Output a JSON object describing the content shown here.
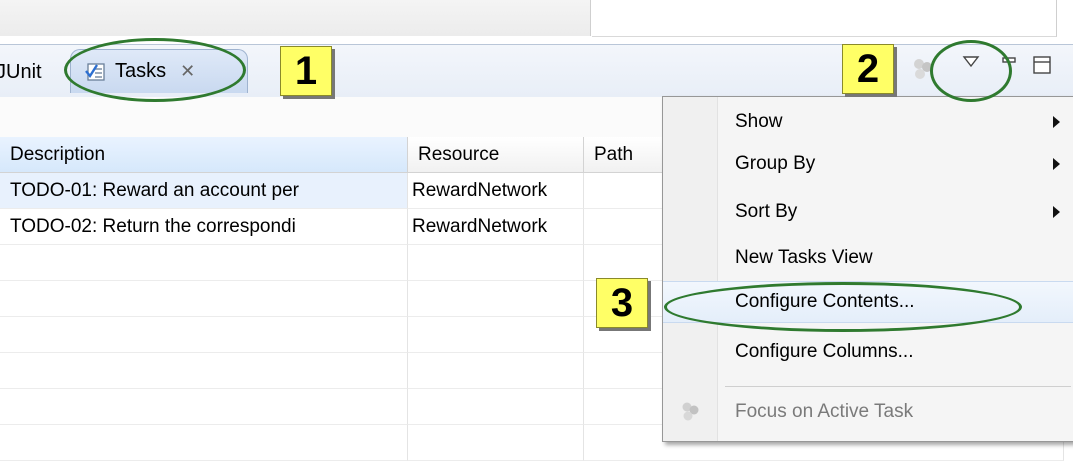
{
  "tabs": {
    "junit_label": "JUnit",
    "tasks_label": "Tasks",
    "close_glyph": "✕"
  },
  "callouts": [
    "1",
    "2",
    "3"
  ],
  "table": {
    "columns": [
      "Description",
      "Resource",
      "Path"
    ],
    "rows": [
      {
        "description": "TODO-01: Reward an account per",
        "resource": "RewardNetwork",
        "path": ""
      },
      {
        "description": "TODO-02: Return the correspondi",
        "resource": "RewardNetwork",
        "path": ""
      }
    ]
  },
  "menu": {
    "items": [
      {
        "label": "Show",
        "submenu": true
      },
      {
        "label": "Group By",
        "submenu": true
      },
      {
        "label": "Sort By",
        "submenu": true
      },
      {
        "label": "New Tasks View",
        "submenu": false
      },
      {
        "label": "Configure Contents...",
        "submenu": false
      },
      {
        "label": "Configure Columns...",
        "submenu": false
      },
      {
        "label": "Focus on Active Task",
        "submenu": false,
        "disabled": true
      }
    ]
  },
  "colors": {
    "callout_fill": "#ffff66",
    "highlight_ring": "#2f7a2f",
    "tab_active": "#c9d9f0"
  },
  "icons": {
    "tasks_tab": "tasks-checklist-icon",
    "view_menu": "view-menu-triangle-icon",
    "minimize": "minimize-icon",
    "maximize": "maximize-icon",
    "focus": "focus-balls-icon"
  }
}
